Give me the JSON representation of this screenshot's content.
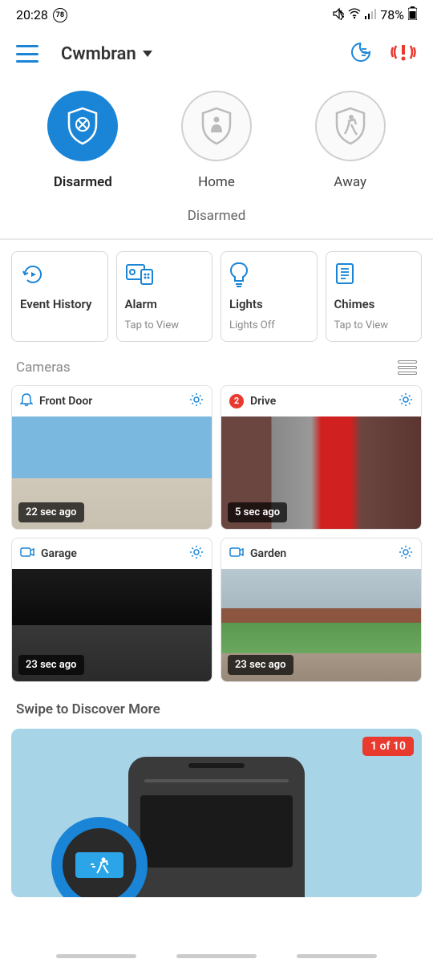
{
  "status_bar": {
    "time": "20:28",
    "notification_count": "78",
    "battery": "78%"
  },
  "header": {
    "location": "Cwmbran"
  },
  "modes": [
    {
      "label": "Disarmed",
      "active": true
    },
    {
      "label": "Home",
      "active": false
    },
    {
      "label": "Away",
      "active": false
    }
  ],
  "status_text": "Disarmed",
  "tiles": [
    {
      "title": "Event History",
      "sub": ""
    },
    {
      "title": "Alarm",
      "sub": "Tap to View"
    },
    {
      "title": "Lights",
      "sub": "Lights Off"
    },
    {
      "title": "Chimes",
      "sub": "Tap to View"
    }
  ],
  "cameras_section": "Cameras",
  "cameras": [
    {
      "name": "Front Door",
      "timestamp": "22 sec ago",
      "badge": null,
      "icon": "bell"
    },
    {
      "name": "Drive",
      "timestamp": "5 sec ago",
      "badge": "2",
      "icon": "cam"
    },
    {
      "name": "Garage",
      "timestamp": "23 sec ago",
      "badge": null,
      "icon": "cam"
    },
    {
      "name": "Garden",
      "timestamp": "23 sec ago",
      "badge": null,
      "icon": "cam"
    }
  ],
  "discover": {
    "title": "Swipe to Discover More",
    "counter": "1 of 10"
  }
}
